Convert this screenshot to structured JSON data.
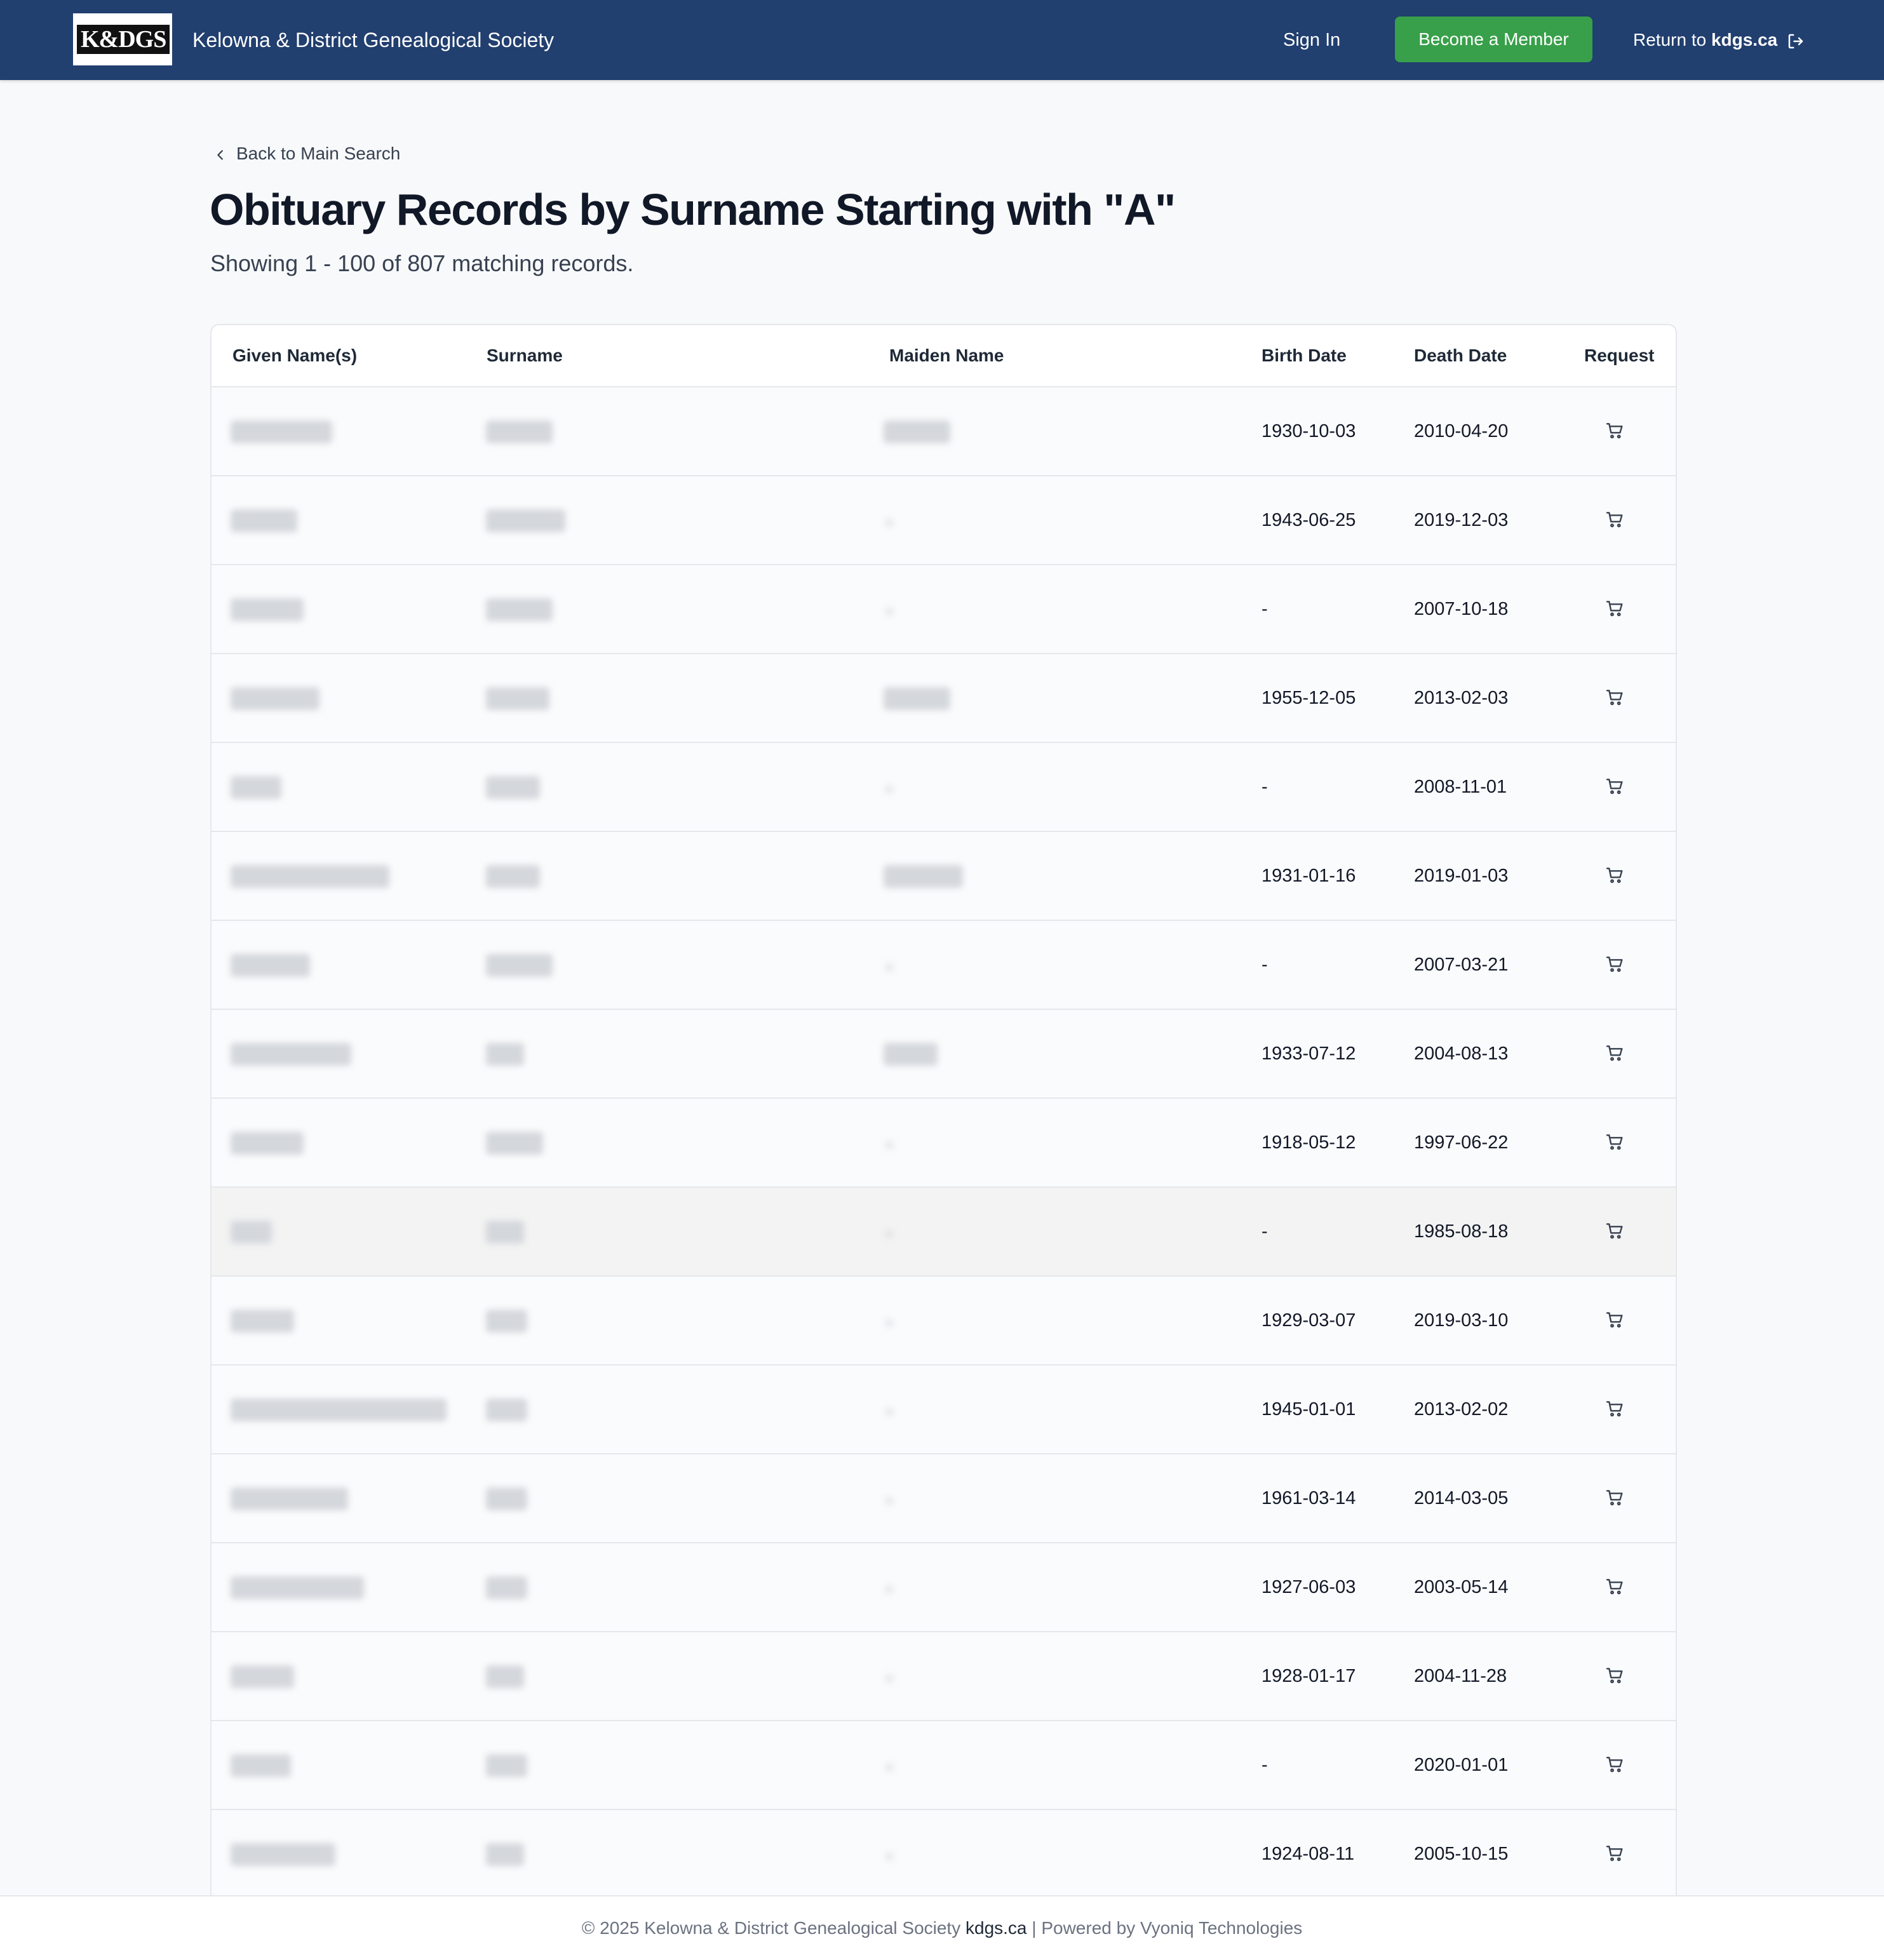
{
  "header": {
    "logo_text": "K&DGS",
    "brand": "Kelowna & District Genealogical Society",
    "sign_in": "Sign In",
    "become_member": "Become a Member",
    "return_prefix": "Return to ",
    "return_site": "kdgs.ca"
  },
  "page": {
    "back_link": "Back to Main Search",
    "title": "Obituary Records by Surname Starting with \"A\"",
    "subtitle": "Showing 1 - 100 of 807 matching records."
  },
  "table": {
    "columns": [
      "Given Name(s)",
      "Surname",
      "Maiden Name",
      "Birth Date",
      "Death Date",
      "Request"
    ],
    "rows": [
      {
        "birth": "1930-10-03",
        "death": "2010-04-20"
      },
      {
        "birth": "1943-06-25",
        "death": "2019-12-03"
      },
      {
        "birth": "-",
        "death": "2007-10-18"
      },
      {
        "birth": "1955-12-05",
        "death": "2013-02-03"
      },
      {
        "birth": "-",
        "death": "2008-11-01"
      },
      {
        "birth": "1931-01-16",
        "death": "2019-01-03"
      },
      {
        "birth": "-",
        "death": "2007-03-21"
      },
      {
        "birth": "1933-07-12",
        "death": "2004-08-13"
      },
      {
        "birth": "1918-05-12",
        "death": "1997-06-22"
      },
      {
        "birth": "-",
        "death": "1985-08-18"
      },
      {
        "birth": "1929-03-07",
        "death": "2019-03-10"
      },
      {
        "birth": "1945-01-01",
        "death": "2013-02-02"
      },
      {
        "birth": "1961-03-14",
        "death": "2014-03-05"
      },
      {
        "birth": "1927-06-03",
        "death": "2003-05-14"
      },
      {
        "birth": "1928-01-17",
        "death": "2004-11-28"
      },
      {
        "birth": "-",
        "death": "2020-01-01"
      },
      {
        "birth": "1924-08-11",
        "death": "2005-10-15"
      }
    ]
  },
  "footer": {
    "copyright": "© 2025 Kelowna & District Genealogical Society ",
    "site": "kdgs.ca",
    "powered": " | Powered by Vyoniq Technologies"
  },
  "colors": {
    "navbar": "#213f6f",
    "member_button": "#38a04a"
  }
}
